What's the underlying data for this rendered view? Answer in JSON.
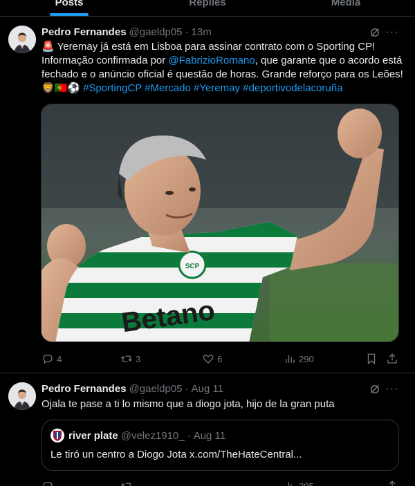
{
  "tabs": [
    {
      "label": "Posts",
      "active": true
    },
    {
      "label": "Replies",
      "active": false
    },
    {
      "label": "Media",
      "active": false
    }
  ],
  "tweets": [
    {
      "name": "Pedro Fernandes",
      "handle": "@gaeldp05",
      "dot": "·",
      "time": "13m",
      "text": {
        "lead_emoji": "🚨",
        "part1": "Yeremay já está em Lisboa para assinar contrato com o Sporting CP! Informação confirmada por ",
        "mention": "@FabrizioRomano",
        "part2": ", que garante que o acordo está fechado e o anúncio oficial é questão de horas. Grande reforço para os Leões! ",
        "emojis": "🦁🇵🇹⚽",
        "hashtags": "#SportingCP #Mercado #Yeremay #deportivodelacoruña"
      },
      "media": {
        "jersey_sponsor": "Betano",
        "badge_text": "SCP",
        "description_icon": "player-photo"
      },
      "stats": {
        "replies": "4",
        "reposts": "3",
        "likes": "6",
        "views": "290"
      }
    },
    {
      "name": "Pedro Fernandes",
      "handle": "@gaeldp05",
      "dot": "·",
      "time": "Aug 11",
      "text": "Ojala te pase a ti lo mismo que a diogo jota, hijo de la gran puta",
      "quote": {
        "name": "river plate",
        "handle": "@velez1910_",
        "dot": "·",
        "time": "Aug 11",
        "text": "Le tiró un centro a Diogo Jota x.com/TheHateCentral..."
      },
      "stats": {
        "views": "295"
      }
    }
  ],
  "colors": {
    "accent": "#1d9bf0",
    "muted": "#71767b",
    "border": "#2f3336",
    "text": "#e7e9ea",
    "sporting_green": "#0b7a3b"
  }
}
